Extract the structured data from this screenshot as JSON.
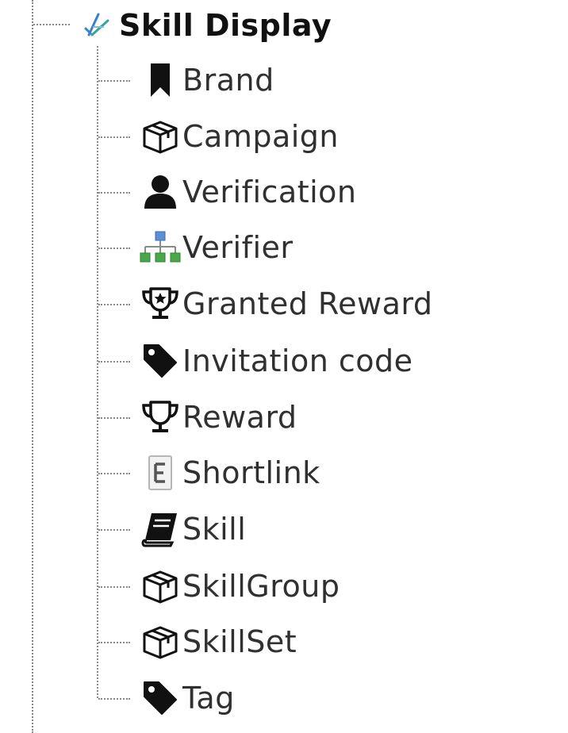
{
  "tree": {
    "root": {
      "label": "Skill Display",
      "icon": "skill-display-icon"
    },
    "children": [
      {
        "label": "Brand",
        "icon": "bookmark-icon"
      },
      {
        "label": "Campaign",
        "icon": "box-icon"
      },
      {
        "label": "Verification",
        "icon": "user-icon"
      },
      {
        "label": "Verifier",
        "icon": "sitemap-icon"
      },
      {
        "label": "Granted Reward",
        "icon": "trophy-star-icon"
      },
      {
        "label": "Invitation code",
        "icon": "tag-icon"
      },
      {
        "label": "Reward",
        "icon": "trophy-icon"
      },
      {
        "label": "Shortlink",
        "icon": "entity-icon"
      },
      {
        "label": "Skill",
        "icon": "book-icon"
      },
      {
        "label": "SkillGroup",
        "icon": "box-icon"
      },
      {
        "label": "SkillSet",
        "icon": "box-icon"
      },
      {
        "label": "Tag",
        "icon": "tag-icon"
      }
    ]
  },
  "colors": {
    "text": "#303030",
    "root_text": "#111111",
    "icon": "#111111",
    "sitemap_blue": "#5b8fd6",
    "sitemap_green": "#49a84a",
    "connector": "#8a8a8a"
  }
}
